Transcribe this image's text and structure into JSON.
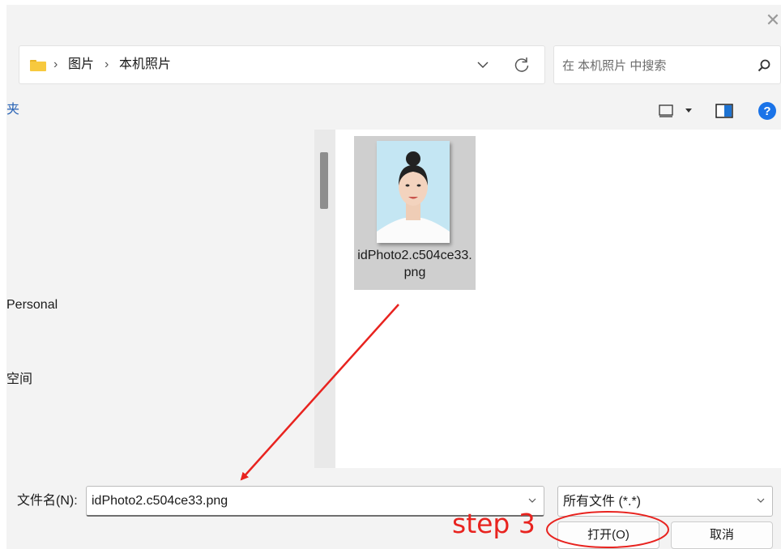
{
  "title_bar": {
    "close_glyph": "✕"
  },
  "address_bar": {
    "breadcrumbs": [
      "图片",
      "本机照片"
    ],
    "separator": "›",
    "icons": {
      "folder": "folder-icon",
      "dropdown": "chevron-down-icon",
      "refresh": "refresh-icon"
    }
  },
  "search": {
    "placeholder": "在 本机照片 中搜索",
    "icon": "search-icon"
  },
  "command_bar": {
    "label": "夹",
    "icons": {
      "view": "view-icon",
      "view_menu": "chevron-down-icon",
      "preview_pane": "preview-pane-icon",
      "help": "help-icon"
    },
    "help_glyph": "?"
  },
  "nav_pane": {
    "items": [
      "Personal",
      "空间"
    ]
  },
  "files": [
    {
      "name": "idPhoto2.c504ce33.png",
      "thumbnail": "portrait-photo-thumbnail"
    }
  ],
  "bottom": {
    "filename_label": "文件名(N):",
    "filename_value": "idPhoto2.c504ce33.png",
    "filetype_value": "所有文件 (*.*)",
    "open_label": "打开(O)",
    "cancel_label": "取消"
  },
  "annotation": {
    "step_text": "step 3",
    "color": "#e8231f"
  },
  "colors": {
    "accent_link": "#2762b5",
    "help_blue": "#1a73e8",
    "selection": "#cfcfcf",
    "thumb_bg": "#c4e6f3"
  }
}
